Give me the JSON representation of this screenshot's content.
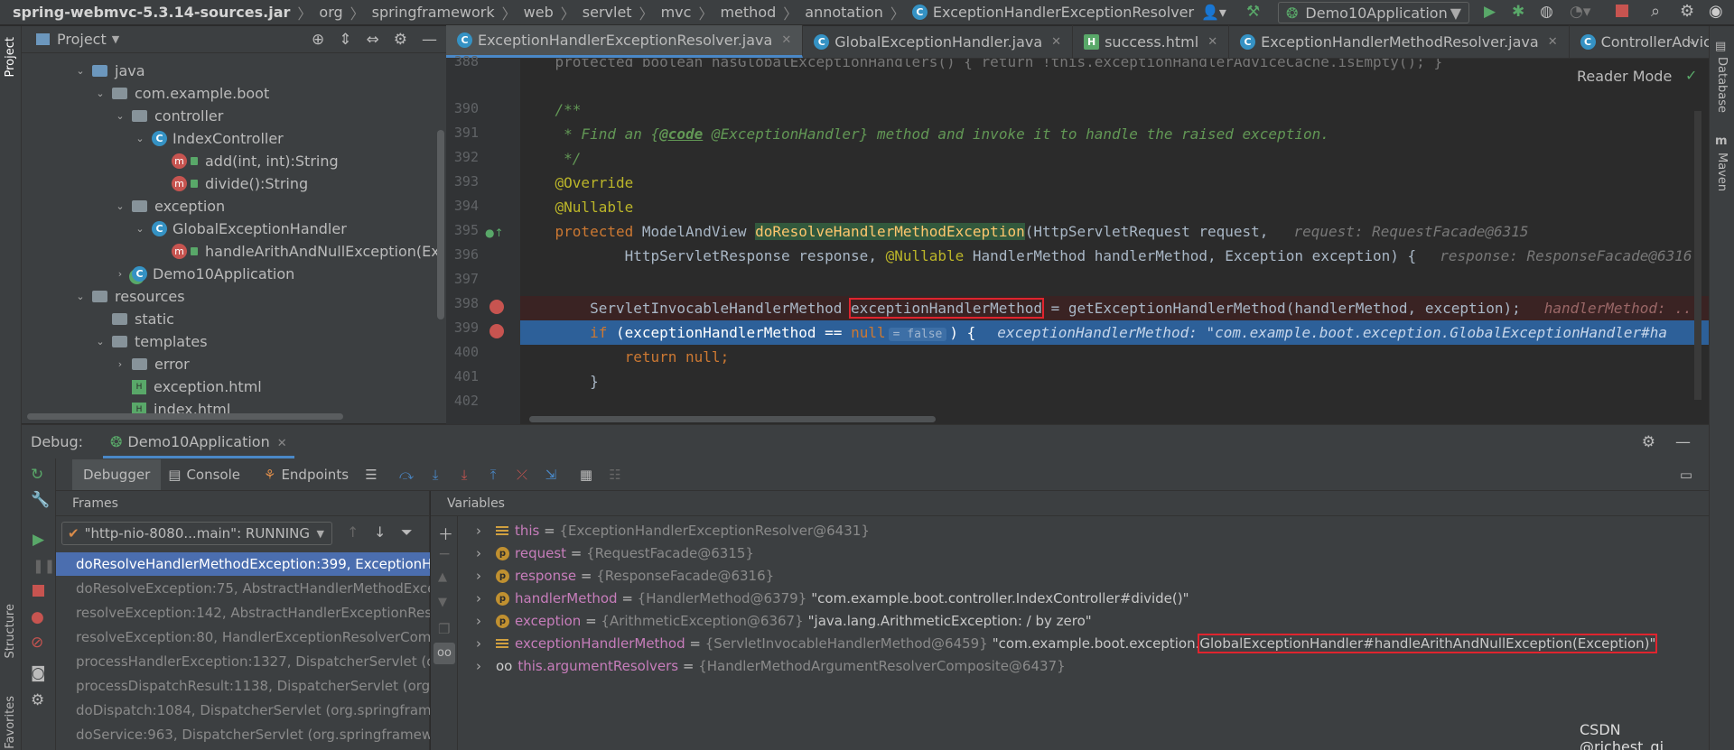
{
  "breadcrumbs": [
    "spring-webmvc-5.3.14-sources.jar",
    "org",
    "springframework",
    "web",
    "servlet",
    "mvc",
    "method",
    "annotation",
    "ExceptionHandlerExceptionResolver"
  ],
  "run_config": "Demo10Application",
  "left_strip": {
    "project": "Project",
    "structure": "Structure",
    "favorites": "Favorites"
  },
  "right_strip": {
    "database": "Database",
    "maven": "Maven"
  },
  "project_panel": {
    "title": "Project",
    "tree": [
      {
        "label": "java",
        "kind": "folder-blue",
        "depth": 3,
        "expanded": true
      },
      {
        "label": "com.example.boot",
        "kind": "folder",
        "depth": 4,
        "expanded": true
      },
      {
        "label": "controller",
        "kind": "folder",
        "depth": 5,
        "expanded": true
      },
      {
        "label": "IndexController",
        "kind": "class",
        "depth": 6,
        "expanded": true
      },
      {
        "label": "add(int, int):String",
        "kind": "method",
        "depth": 7
      },
      {
        "label": "divide():String",
        "kind": "method",
        "depth": 7
      },
      {
        "label": "exception",
        "kind": "folder",
        "depth": 5,
        "expanded": true
      },
      {
        "label": "GlobalExceptionHandler",
        "kind": "class",
        "depth": 6,
        "expanded": true
      },
      {
        "label": "handleArithAndNullException(Ex",
        "kind": "method",
        "depth": 7
      },
      {
        "label": "Demo10Application",
        "kind": "class-run",
        "depth": 5,
        "expanded": false
      },
      {
        "label": "resources",
        "kind": "folder",
        "depth": 3,
        "expanded": true
      },
      {
        "label": "static",
        "kind": "folder",
        "depth": 4
      },
      {
        "label": "templates",
        "kind": "folder",
        "depth": 4,
        "expanded": true
      },
      {
        "label": "error",
        "kind": "folder",
        "depth": 5,
        "expanded": false
      },
      {
        "label": "exception.html",
        "kind": "html",
        "depth": 5
      },
      {
        "label": "index.html",
        "kind": "html",
        "depth": 5
      }
    ]
  },
  "editor": {
    "tabs": [
      {
        "label": "ExceptionHandlerExceptionResolver.java",
        "active": true
      },
      {
        "label": "GlobalExceptionHandler.java",
        "active": false
      },
      {
        "label": "success.html",
        "active": false
      },
      {
        "label": "ExceptionHandlerMethodResolver.java",
        "active": false
      },
      {
        "label": "ControllerAdviceBean.java",
        "active": false
      }
    ],
    "reader_mode": "Reader Mode",
    "line_numbers": [
      "388",
      "390",
      "391",
      "392",
      "393",
      "394",
      "395",
      "396",
      "397",
      "398",
      "399",
      "400",
      "401",
      "402"
    ],
    "lines": {
      "l388": "    protected boolean hasGlobalExceptionHandlers() { return !this.exceptionHandlerAdviceCache.isEmpty(); }",
      "l390_comment": "    /**",
      "l391_a": "     * Find an {",
      "l391_code": "@code",
      "l391_b": " @ExceptionHandler} method and invoke it to handle the raised exception.",
      "l392": "     */",
      "l393": "    @Override",
      "l394": "    @Nullable",
      "l395_kw": "    protected ",
      "l395_type": "ModelAndView ",
      "l395_fn": "doResolveHandlerMethodException",
      "l395_rest": "(HttpServletRequest request,",
      "l395_hint": "request: RequestFacade@6315",
      "l396_a": "            HttpServletResponse response, ",
      "l396_an": "@Nullable",
      "l396_b": " HandlerMethod handlerMethod, Exception exception) {",
      "l396_hint": "response: ResponseFacade@6316",
      "l398_a": "        ServletInvocableHandlerMethod ",
      "l398_box": "exceptionHandlerMethod",
      "l398_b": " = getExceptionHandlerMethod(handlerMethod, exception);",
      "l398_hint": "handlerMethod: ...",
      "l399_kw": "        if ",
      "l399_a": "(exceptionHandlerMethod == ",
      "l399_null": "null",
      "l399_eq": "= false",
      "l399_b": ") {",
      "l399_hint": "exceptionHandlerMethod: \"com.example.boot.exception.GlobalExceptionHandler#ha",
      "l400_kw": "            return ",
      "l400_b": "null;",
      "l401": "        }"
    }
  },
  "debug": {
    "label": "Debug:",
    "session": "Demo10Application",
    "tabs": [
      "Debugger",
      "Console",
      "Endpoints"
    ],
    "frames_title": "Frames",
    "variables_title": "Variables",
    "thread": "\"http-nio-8080...main\": RUNNING",
    "frames": [
      {
        "text": "doResolveHandlerMethodException:399, ExceptionHa",
        "selected": true
      },
      {
        "text": "doResolveException:75, AbstractHandlerMethodExce"
      },
      {
        "text": "resolveException:142, AbstractHandlerExceptionReso"
      },
      {
        "text": "resolveException:80, HandlerExceptionResolverComp"
      },
      {
        "text": "processHandlerException:1327, DispatcherServlet (org"
      },
      {
        "text": "processDispatchResult:1138, DispatcherServlet (org.sp"
      },
      {
        "text": "doDispatch:1084, DispatcherServlet (org.springframew"
      },
      {
        "text": "doService:963, DispatcherServlet (org.springframewor"
      }
    ],
    "variables": [
      {
        "icon": "eq",
        "name": "this",
        "type": "{ExceptionHandlerExceptionResolver@6431}",
        "value": ""
      },
      {
        "icon": "p",
        "name": "request",
        "type": "{RequestFacade@6315}",
        "value": ""
      },
      {
        "icon": "p",
        "name": "response",
        "type": "{ResponseFacade@6316}",
        "value": ""
      },
      {
        "icon": "p",
        "name": "handlerMethod",
        "type": "{HandlerMethod@6379}",
        "value": "\"com.example.boot.controller.IndexController#divide()\""
      },
      {
        "icon": "p",
        "name": "exception",
        "type": "{ArithmeticException@6367}",
        "value": "\"java.lang.ArithmeticException: / by zero\""
      },
      {
        "icon": "eq",
        "name": "exceptionHandlerMethod",
        "type": "{ServletInvocableHandlerMethod@6459}",
        "value_a": "\"com.example.boot.exception.",
        "value_box": "GlobalExceptionHandler#handleArithAndNullException(Exception)\""
      },
      {
        "icon": "oo",
        "name": "this.argumentResolvers",
        "type": "{HandlerMethodArgumentResolverComposite@6437}",
        "value": ""
      }
    ]
  },
  "watermark": "CSDN @richest_qi",
  "colors": {
    "accent": "#4a88c7",
    "selection": "#214283",
    "frame_sel": "#4b6eaf",
    "breakpoint": "#c75450",
    "highlight_box": "#e0242e"
  }
}
